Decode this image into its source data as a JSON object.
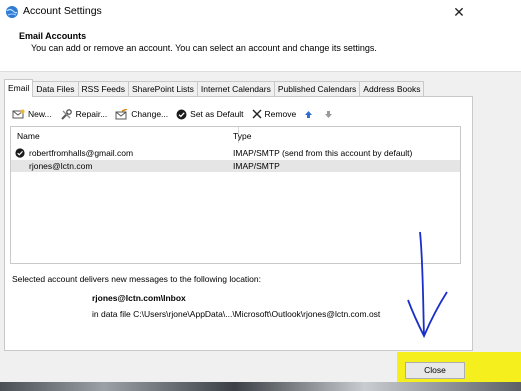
{
  "window": {
    "title": "Account Settings",
    "close_glyph": "✕"
  },
  "header": {
    "title": "Email Accounts",
    "subtitle": "You can add or remove an account. You can select an account and change its settings."
  },
  "tabs": [
    "Email",
    "Data Files",
    "RSS Feeds",
    "SharePoint Lists",
    "Internet Calendars",
    "Published Calendars",
    "Address Books"
  ],
  "active_tab": "Email",
  "toolbar": {
    "new_label": "New...",
    "repair_label": "Repair...",
    "change_label": "Change...",
    "default_label": "Set as Default",
    "remove_label": "Remove"
  },
  "list": {
    "col_name": "Name",
    "col_type": "Type",
    "rows": [
      {
        "name": "robertfromhalls@gmail.com",
        "type": "IMAP/SMTP (send from this account by default)",
        "default": true
      },
      {
        "name": "rjones@lctn.com",
        "type": "IMAP/SMTP",
        "selected": true
      }
    ]
  },
  "location": {
    "label": "Selected account delivers new messages to the following location:",
    "folder": "rjones@lctn.com\\Inbox",
    "file": "in data file C:\\Users\\rjone\\AppData\\...\\Microsoft\\Outlook\\rjones@lctn.com.ost"
  },
  "footer": {
    "close_label": "Close"
  },
  "colors": {
    "highlight": "#f5ef1e",
    "annotation": "#1a2fc9",
    "selection": "#e5e5e5"
  }
}
